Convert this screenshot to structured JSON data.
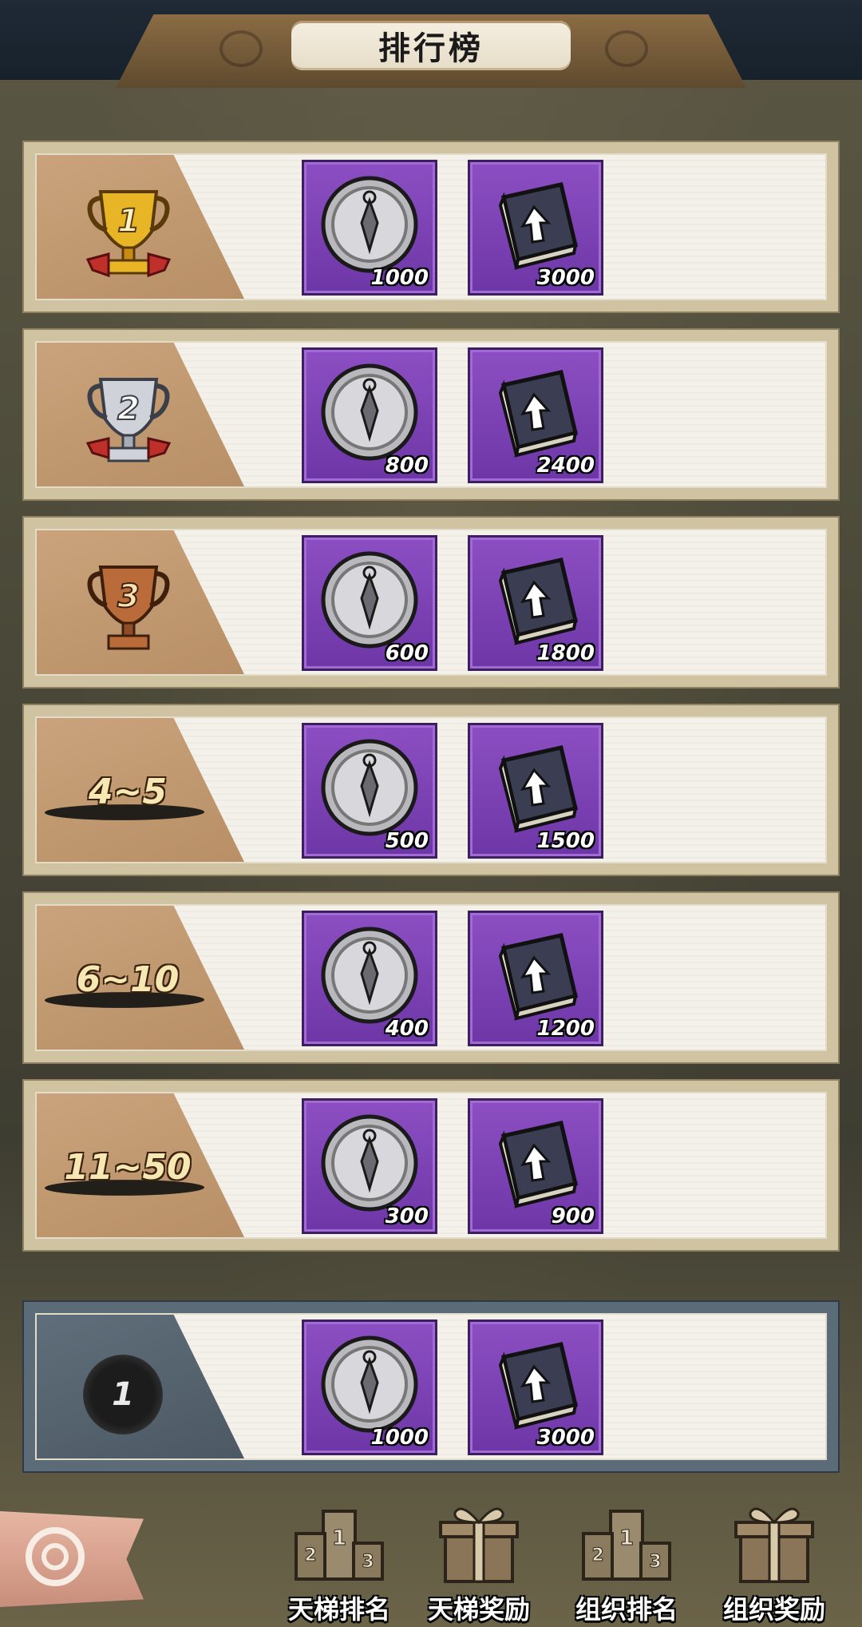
{
  "header": {
    "title": "排行榜"
  },
  "rows": [
    {
      "rank": "1",
      "rank_style": "gold-trophy",
      "items": [
        {
          "icon": "kunai-coin-icon",
          "qty": "1000"
        },
        {
          "icon": "upgrade-book-icon",
          "qty": "3000"
        }
      ]
    },
    {
      "rank": "2",
      "rank_style": "silver-trophy",
      "items": [
        {
          "icon": "kunai-coin-icon",
          "qty": "800"
        },
        {
          "icon": "upgrade-book-icon",
          "qty": "2400"
        }
      ]
    },
    {
      "rank": "3",
      "rank_style": "bronze-trophy",
      "items": [
        {
          "icon": "kunai-coin-icon",
          "qty": "600"
        },
        {
          "icon": "upgrade-book-icon",
          "qty": "1800"
        }
      ]
    },
    {
      "rank": "4~5",
      "rank_style": "ink-label",
      "items": [
        {
          "icon": "kunai-coin-icon",
          "qty": "500"
        },
        {
          "icon": "upgrade-book-icon",
          "qty": "1500"
        }
      ]
    },
    {
      "rank": "6~10",
      "rank_style": "ink-label",
      "items": [
        {
          "icon": "kunai-coin-icon",
          "qty": "400"
        },
        {
          "icon": "upgrade-book-icon",
          "qty": "1200"
        }
      ]
    },
    {
      "rank": "11~50",
      "rank_style": "ink-label",
      "items": [
        {
          "icon": "kunai-coin-icon",
          "qty": "300"
        },
        {
          "icon": "upgrade-book-icon",
          "qty": "900"
        }
      ]
    }
  ],
  "my_row": {
    "rank": "1",
    "items": [
      {
        "icon": "kunai-coin-icon",
        "qty": "1000"
      },
      {
        "icon": "upgrade-book-icon",
        "qty": "3000"
      }
    ]
  },
  "nav": [
    {
      "label": "天梯排名",
      "icon": "podium-icon"
    },
    {
      "label": "天梯奖励",
      "icon": "gift-box-icon"
    },
    {
      "label": "组织排名",
      "icon": "podium-icon"
    },
    {
      "label": "组织奖励",
      "icon": "gift-box-icon"
    }
  ],
  "colors": {
    "item_bg": "#7b42b5",
    "gold": "#d8a21e",
    "silver": "#c8ccd2",
    "bronze": "#b36b3a"
  }
}
